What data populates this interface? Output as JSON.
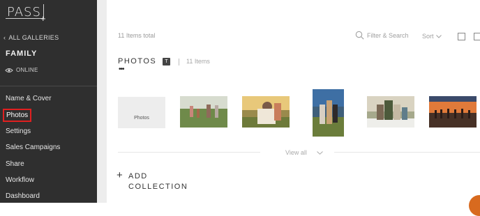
{
  "brand": {
    "logo_text": "PASS",
    "logo_plus": "+"
  },
  "sidebar": {
    "back_label": "ALL GALLERIES",
    "gallery_name": "FAMILY",
    "status": "ONLINE",
    "items": [
      {
        "label": "Name & Cover"
      },
      {
        "label": "Photos",
        "active": true
      },
      {
        "label": "Settings"
      },
      {
        "label": "Sales Campaigns"
      },
      {
        "label": "Share"
      },
      {
        "label": "Workflow"
      },
      {
        "label": "Dashboard"
      }
    ]
  },
  "toolbar": {
    "items_total": "11 Items total",
    "search_placeholder": "Filter & Search",
    "sort_label": "Sort"
  },
  "section": {
    "title": "PHOTOS",
    "dots": "•••",
    "badge": "T",
    "count": "11 Items",
    "placeholder_label": "Photos",
    "view_all": "View all"
  },
  "add_collection": {
    "plus": "+",
    "line1": "ADD",
    "line2": "COLLECTION"
  },
  "colors": {
    "sidebar_bg": "#2f2f2f",
    "active_outline": "#e02020",
    "accent_orange": "#d86a1f"
  }
}
